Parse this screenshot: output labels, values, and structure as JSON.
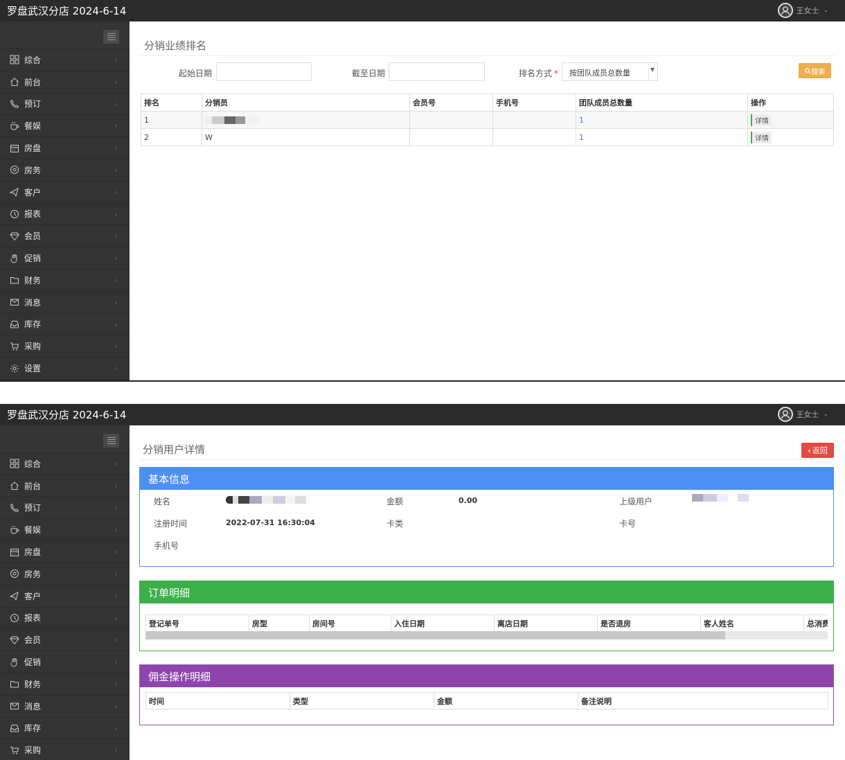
{
  "app": {
    "title": "罗盘武汉分店 2024-6-14",
    "user_name": "王女士"
  },
  "sidebar": {
    "items": [
      {
        "label": "综合",
        "icon": "grid-icon"
      },
      {
        "label": "前台",
        "icon": "home-icon"
      },
      {
        "label": "预订",
        "icon": "phone-icon"
      },
      {
        "label": "餐娱",
        "icon": "cup-icon"
      },
      {
        "label": "房盘",
        "icon": "calendar-icon"
      },
      {
        "label": "房务",
        "icon": "settings-wheel-icon"
      },
      {
        "label": "客户",
        "icon": "plane-icon"
      },
      {
        "label": "报表",
        "icon": "clock-icon"
      },
      {
        "label": "会员",
        "icon": "diamond-icon"
      },
      {
        "label": "促销",
        "icon": "hand-icon"
      },
      {
        "label": "财务",
        "icon": "folder-icon"
      },
      {
        "label": "消息",
        "icon": "mail-icon"
      },
      {
        "label": "库存",
        "icon": "inbox-icon"
      },
      {
        "label": "采购",
        "icon": "cart-icon"
      },
      {
        "label": "设置",
        "icon": "gear-icon"
      }
    ]
  },
  "ranking_page": {
    "title": "分销业绩排名",
    "filters": {
      "start_label": "起始日期",
      "start_value": "",
      "end_label": "截至日期",
      "end_value": "",
      "sort_label": "排名方式",
      "sort_value": "按团队成员总数量",
      "search_label": "搜索"
    },
    "table": {
      "headers": [
        "排名",
        "分销员",
        "会员号",
        "手机号",
        "团队成员总数量",
        "操作"
      ],
      "rows": [
        {
          "rank": "1",
          "name": "",
          "member_no": "",
          "phone": "",
          "team_count": "1",
          "action": "详情"
        },
        {
          "rank": "2",
          "name": "W",
          "member_no": "",
          "phone": "",
          "team_count": "1",
          "action": "详情"
        }
      ]
    }
  },
  "detail_page": {
    "title": "分销用户详情",
    "back_label": "返回",
    "basic_info": {
      "header": "基本信息",
      "name_label": "姓名",
      "amount_label": "金额",
      "amount_value": "0.00",
      "parent_label": "上级用户",
      "reg_time_label": "注册时间",
      "reg_time_value": "2022-07-31 16:30:04",
      "card_type_label": "卡类",
      "card_no_label": "卡号",
      "phone_label": "手机号"
    },
    "order_detail": {
      "header": "订单明细",
      "columns": [
        "登记单号",
        "房型",
        "房间号",
        "入住日期",
        "离店日期",
        "是否退房",
        "客人姓名",
        "总消费"
      ],
      "scroll_fraction": 0.85
    },
    "commission_detail": {
      "header": "佣金操作明细",
      "columns": [
        "时间",
        "类型",
        "金额",
        "备注说明"
      ]
    }
  }
}
